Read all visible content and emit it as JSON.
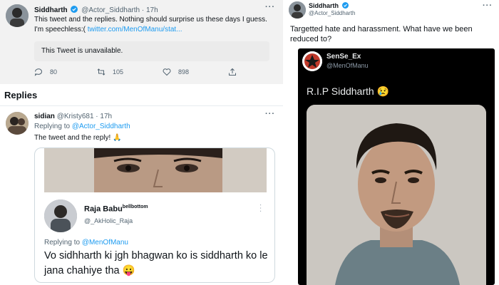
{
  "left": {
    "top_tweet": {
      "name": "Siddharth",
      "handle_time": "@Actor_Siddharth · 17h",
      "more": "···",
      "text_line1": "This tweet and the replies. Nothing should surprise us these days I guess.",
      "text_line2_prefix": "I'm speechless:( ",
      "link": "twitter.com/MenOfManu/stat...",
      "unavailable": "This Tweet is unavailable.",
      "reply_count": "80",
      "retweet_count": "105",
      "like_count": "898"
    },
    "replies_heading": "Replies",
    "reply": {
      "name": "sidian",
      "handle_time": "@Kristy681 · 17h",
      "more": "···",
      "replying_prefix": "Replying to ",
      "replying_to": "@Actor_Siddharth",
      "text": "The tweet and the reply! 🙏",
      "quote": {
        "name": "Raja Babu",
        "name_sup": "bellbottom",
        "handle": "@_AkHolic_Raja",
        "more": "···",
        "replying_prefix": "Replying to ",
        "replying_to": "@MenOfManu",
        "text": "Vo sidhharth ki jgh bhagwan ko is siddharth ko le jana chahiye tha 😛"
      }
    }
  },
  "right": {
    "tweet": {
      "name": "Siddharth",
      "handle": "@Actor_Siddharth",
      "more": "···",
      "text": "Targetted hate and harassment. What have we been reduced to?"
    },
    "embedded_post": {
      "name": "SenSe_Ex",
      "handle": "@MenOfManu",
      "text": "R.I.P Siddharth 😢"
    }
  },
  "colors": {
    "accent": "#1d9bf0",
    "text": "#0f1419",
    "muted": "#536471",
    "dark_bg": "#000000"
  }
}
